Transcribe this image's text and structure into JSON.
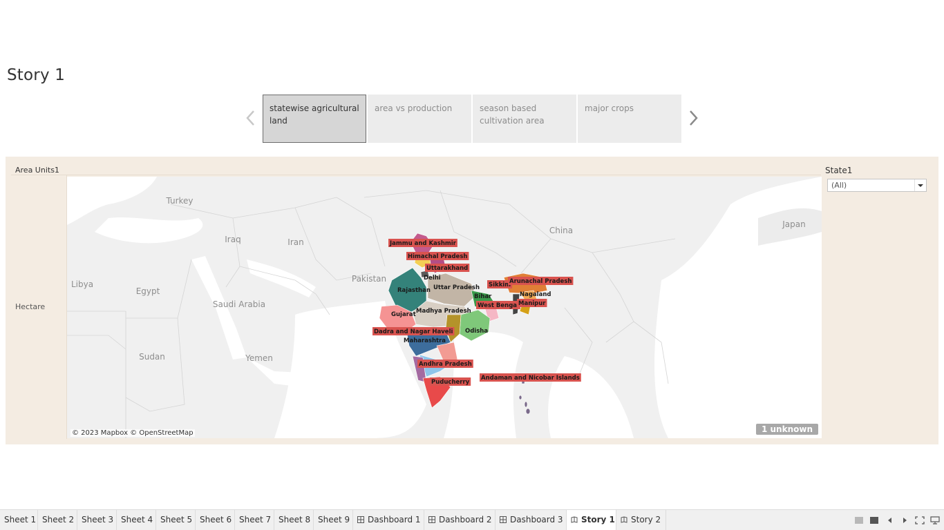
{
  "story": {
    "title": "Story 1"
  },
  "story_points": [
    {
      "label": "statewise agricultural land",
      "active": true
    },
    {
      "label": "area vs production",
      "active": false
    },
    {
      "label": "season based cultivation area",
      "active": false
    },
    {
      "label": "major crops",
      "active": false
    }
  ],
  "dashboard": {
    "column_header": "Area Units1",
    "row_label": "Hectare",
    "map": {
      "attribution": "© 2023 Mapbox © OpenStreetMap",
      "unknown_badge": "1 unknown",
      "countries": [
        "Turkey",
        "Iraq",
        "Iran",
        "Libya",
        "Egypt",
        "Saudi Arabia",
        "Sudan",
        "Yemen",
        "Pakistan",
        "China",
        "Japan"
      ],
      "states": [
        "Jammu and Kashmir",
        "Himachal Pradesh",
        "Uttarakhand",
        "Delhi",
        "Rajasthan",
        "Uttar Pradesh",
        "Sikkim",
        "Arunachal Pradesh",
        "Bihar",
        "Nagaland",
        "West Bengal",
        "Manipur",
        "Madhya Pradesh",
        "Gujarat",
        "Odisha",
        "Dadra and Nagar Haveli",
        "Maharashtra",
        "Andhra Pradesh",
        "Puducherry",
        "Andaman and Nicobar Islands"
      ]
    },
    "filter": {
      "title": "State1",
      "value": "(All)"
    }
  },
  "tabs": [
    {
      "label": "Sheet 1",
      "type": "sheet"
    },
    {
      "label": "Sheet 2",
      "type": "sheet"
    },
    {
      "label": "Sheet 3",
      "type": "sheet"
    },
    {
      "label": "Sheet 4",
      "type": "sheet"
    },
    {
      "label": "Sheet 5",
      "type": "sheet"
    },
    {
      "label": "Sheet 6",
      "type": "sheet"
    },
    {
      "label": "Sheet 7",
      "type": "sheet"
    },
    {
      "label": "Sheet 8",
      "type": "sheet"
    },
    {
      "label": "Sheet 9",
      "type": "sheet"
    },
    {
      "label": "Dashboard 1",
      "type": "dashboard"
    },
    {
      "label": "Dashboard 2",
      "type": "dashboard"
    },
    {
      "label": "Dashboard 3",
      "type": "dashboard"
    },
    {
      "label": "Story 1",
      "type": "story",
      "active": true
    },
    {
      "label": "Story 2",
      "type": "story"
    }
  ],
  "colors": {
    "dashboard_bg": "#f4ece2",
    "label_bg": "#d9534f",
    "active_point": "#d6d6d6"
  }
}
